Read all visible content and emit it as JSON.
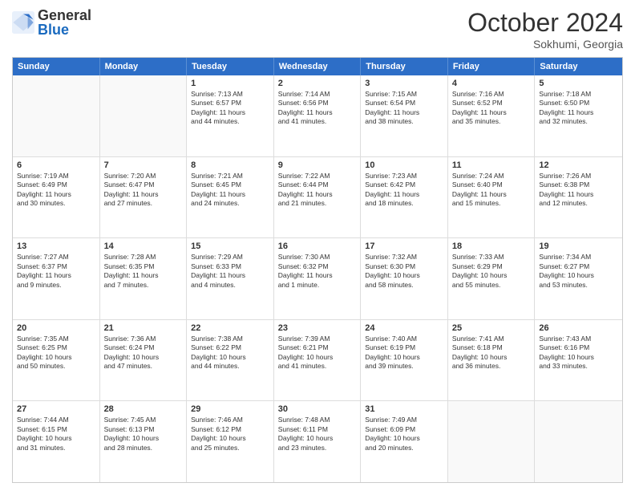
{
  "logo": {
    "general": "General",
    "blue": "Blue"
  },
  "title": "October 2024",
  "location": "Sokhumi, Georgia",
  "days": [
    "Sunday",
    "Monday",
    "Tuesday",
    "Wednesday",
    "Thursday",
    "Friday",
    "Saturday"
  ],
  "rows": [
    [
      {
        "day": "",
        "lines": []
      },
      {
        "day": "",
        "lines": []
      },
      {
        "day": "1",
        "lines": [
          "Sunrise: 7:13 AM",
          "Sunset: 6:57 PM",
          "Daylight: 11 hours",
          "and 44 minutes."
        ]
      },
      {
        "day": "2",
        "lines": [
          "Sunrise: 7:14 AM",
          "Sunset: 6:56 PM",
          "Daylight: 11 hours",
          "and 41 minutes."
        ]
      },
      {
        "day": "3",
        "lines": [
          "Sunrise: 7:15 AM",
          "Sunset: 6:54 PM",
          "Daylight: 11 hours",
          "and 38 minutes."
        ]
      },
      {
        "day": "4",
        "lines": [
          "Sunrise: 7:16 AM",
          "Sunset: 6:52 PM",
          "Daylight: 11 hours",
          "and 35 minutes."
        ]
      },
      {
        "day": "5",
        "lines": [
          "Sunrise: 7:18 AM",
          "Sunset: 6:50 PM",
          "Daylight: 11 hours",
          "and 32 minutes."
        ]
      }
    ],
    [
      {
        "day": "6",
        "lines": [
          "Sunrise: 7:19 AM",
          "Sunset: 6:49 PM",
          "Daylight: 11 hours",
          "and 30 minutes."
        ]
      },
      {
        "day": "7",
        "lines": [
          "Sunrise: 7:20 AM",
          "Sunset: 6:47 PM",
          "Daylight: 11 hours",
          "and 27 minutes."
        ]
      },
      {
        "day": "8",
        "lines": [
          "Sunrise: 7:21 AM",
          "Sunset: 6:45 PM",
          "Daylight: 11 hours",
          "and 24 minutes."
        ]
      },
      {
        "day": "9",
        "lines": [
          "Sunrise: 7:22 AM",
          "Sunset: 6:44 PM",
          "Daylight: 11 hours",
          "and 21 minutes."
        ]
      },
      {
        "day": "10",
        "lines": [
          "Sunrise: 7:23 AM",
          "Sunset: 6:42 PM",
          "Daylight: 11 hours",
          "and 18 minutes."
        ]
      },
      {
        "day": "11",
        "lines": [
          "Sunrise: 7:24 AM",
          "Sunset: 6:40 PM",
          "Daylight: 11 hours",
          "and 15 minutes."
        ]
      },
      {
        "day": "12",
        "lines": [
          "Sunrise: 7:26 AM",
          "Sunset: 6:38 PM",
          "Daylight: 11 hours",
          "and 12 minutes."
        ]
      }
    ],
    [
      {
        "day": "13",
        "lines": [
          "Sunrise: 7:27 AM",
          "Sunset: 6:37 PM",
          "Daylight: 11 hours",
          "and 9 minutes."
        ]
      },
      {
        "day": "14",
        "lines": [
          "Sunrise: 7:28 AM",
          "Sunset: 6:35 PM",
          "Daylight: 11 hours",
          "and 7 minutes."
        ]
      },
      {
        "day": "15",
        "lines": [
          "Sunrise: 7:29 AM",
          "Sunset: 6:33 PM",
          "Daylight: 11 hours",
          "and 4 minutes."
        ]
      },
      {
        "day": "16",
        "lines": [
          "Sunrise: 7:30 AM",
          "Sunset: 6:32 PM",
          "Daylight: 11 hours",
          "and 1 minute."
        ]
      },
      {
        "day": "17",
        "lines": [
          "Sunrise: 7:32 AM",
          "Sunset: 6:30 PM",
          "Daylight: 10 hours",
          "and 58 minutes."
        ]
      },
      {
        "day": "18",
        "lines": [
          "Sunrise: 7:33 AM",
          "Sunset: 6:29 PM",
          "Daylight: 10 hours",
          "and 55 minutes."
        ]
      },
      {
        "day": "19",
        "lines": [
          "Sunrise: 7:34 AM",
          "Sunset: 6:27 PM",
          "Daylight: 10 hours",
          "and 53 minutes."
        ]
      }
    ],
    [
      {
        "day": "20",
        "lines": [
          "Sunrise: 7:35 AM",
          "Sunset: 6:25 PM",
          "Daylight: 10 hours",
          "and 50 minutes."
        ]
      },
      {
        "day": "21",
        "lines": [
          "Sunrise: 7:36 AM",
          "Sunset: 6:24 PM",
          "Daylight: 10 hours",
          "and 47 minutes."
        ]
      },
      {
        "day": "22",
        "lines": [
          "Sunrise: 7:38 AM",
          "Sunset: 6:22 PM",
          "Daylight: 10 hours",
          "and 44 minutes."
        ]
      },
      {
        "day": "23",
        "lines": [
          "Sunrise: 7:39 AM",
          "Sunset: 6:21 PM",
          "Daylight: 10 hours",
          "and 41 minutes."
        ]
      },
      {
        "day": "24",
        "lines": [
          "Sunrise: 7:40 AM",
          "Sunset: 6:19 PM",
          "Daylight: 10 hours",
          "and 39 minutes."
        ]
      },
      {
        "day": "25",
        "lines": [
          "Sunrise: 7:41 AM",
          "Sunset: 6:18 PM",
          "Daylight: 10 hours",
          "and 36 minutes."
        ]
      },
      {
        "day": "26",
        "lines": [
          "Sunrise: 7:43 AM",
          "Sunset: 6:16 PM",
          "Daylight: 10 hours",
          "and 33 minutes."
        ]
      }
    ],
    [
      {
        "day": "27",
        "lines": [
          "Sunrise: 7:44 AM",
          "Sunset: 6:15 PM",
          "Daylight: 10 hours",
          "and 31 minutes."
        ]
      },
      {
        "day": "28",
        "lines": [
          "Sunrise: 7:45 AM",
          "Sunset: 6:13 PM",
          "Daylight: 10 hours",
          "and 28 minutes."
        ]
      },
      {
        "day": "29",
        "lines": [
          "Sunrise: 7:46 AM",
          "Sunset: 6:12 PM",
          "Daylight: 10 hours",
          "and 25 minutes."
        ]
      },
      {
        "day": "30",
        "lines": [
          "Sunrise: 7:48 AM",
          "Sunset: 6:11 PM",
          "Daylight: 10 hours",
          "and 23 minutes."
        ]
      },
      {
        "day": "31",
        "lines": [
          "Sunrise: 7:49 AM",
          "Sunset: 6:09 PM",
          "Daylight: 10 hours",
          "and 20 minutes."
        ]
      },
      {
        "day": "",
        "lines": []
      },
      {
        "day": "",
        "lines": []
      }
    ]
  ]
}
